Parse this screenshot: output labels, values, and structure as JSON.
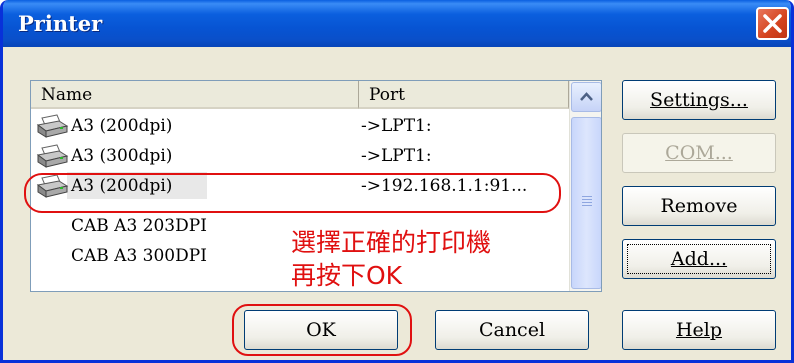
{
  "window": {
    "title": "Printer"
  },
  "list": {
    "columns": {
      "name": "Name",
      "port": "Port"
    },
    "rows": [
      {
        "name": "A3 (200dpi)",
        "port": "->LPT1:",
        "icon": "printer-icon"
      },
      {
        "name": "A3 (300dpi)",
        "port": "->LPT1:",
        "icon": "printer-icon"
      },
      {
        "name": "A3 (200dpi)",
        "port": "->192.168.1.1:91...",
        "icon": "printer-icon"
      },
      {
        "name": "CAB A3 203DPI",
        "port": ""
      },
      {
        "name": "CAB A3 300DPI",
        "port": ""
      }
    ]
  },
  "buttons": {
    "settings": {
      "label": "Settings...",
      "enabled": true
    },
    "com": {
      "label": "COM...",
      "enabled": false
    },
    "remove": {
      "label": "Remove",
      "enabled": true
    },
    "add": {
      "label": "Add...",
      "enabled": true
    },
    "ok": {
      "label": "OK",
      "enabled": true
    },
    "cancel": {
      "label": "Cancel",
      "enabled": true
    },
    "help": {
      "label": "Help",
      "enabled": true
    }
  },
  "annotation": {
    "line1": "選擇正確的打印機",
    "line2": "再按下OK",
    "color": "#e01010"
  },
  "colors": {
    "titlebar": "#0754d3",
    "close": "#d4431e",
    "face": "#ece9d8"
  }
}
